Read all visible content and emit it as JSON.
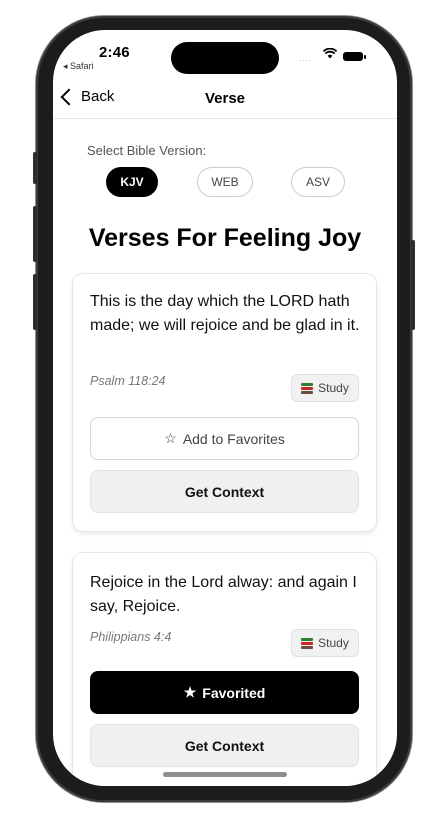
{
  "status_bar": {
    "time": "2:46",
    "back_app": "◂ Safari",
    "signal_dots": "....",
    "wifi_glyph": "📶"
  },
  "nav": {
    "back_label": "Back",
    "title": "Verse"
  },
  "version_select": {
    "label": "Select Bible Version:",
    "options": [
      "KJV",
      "WEB",
      "ASV"
    ],
    "selected": "KJV"
  },
  "page_title": "Verses For Feeling Joy",
  "verses": [
    {
      "text": "This is the day which the LORD hath made; we will rejoice and be glad in it.",
      "reference": "Psalm 118:24",
      "study_label": "Study",
      "favorite_label": "Add to Favorites",
      "favorite_state": "not-favorited",
      "favorite_star": "☆",
      "context_label": "Get Context"
    },
    {
      "text": "Rejoice in the Lord alway: and again I say, Rejoice.",
      "reference": "Philippians 4:4",
      "study_label": "Study",
      "favorite_label": "Favorited",
      "favorite_state": "favorited",
      "favorite_star": "★",
      "context_label": "Get Context"
    }
  ],
  "colors": {
    "accent": "#000000",
    "pill_border": "#cccccc",
    "button_gray": "#f0f0f0"
  }
}
